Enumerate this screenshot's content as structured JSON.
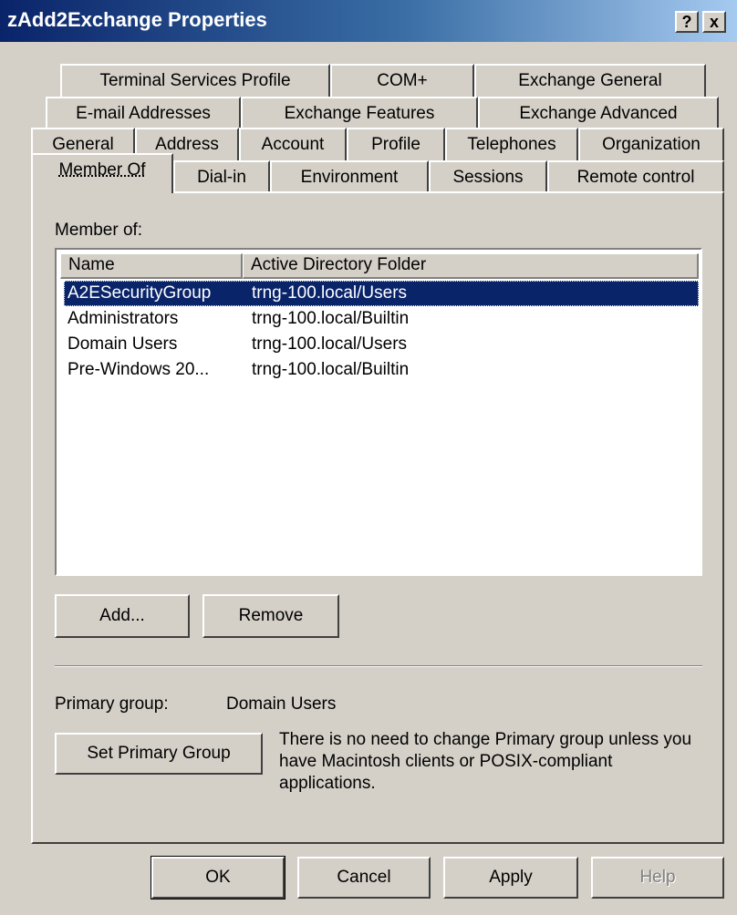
{
  "window": {
    "title": "zAdd2Exchange Properties",
    "help_button": "?",
    "close_button": "x"
  },
  "tabs": {
    "row1": [
      "Terminal Services Profile",
      "COM+",
      "Exchange General"
    ],
    "row2": [
      "E-mail Addresses",
      "Exchange Features",
      "Exchange Advanced"
    ],
    "row3": [
      "General",
      "Address",
      "Account",
      "Profile",
      "Telephones",
      "Organization"
    ],
    "row4": [
      "Member Of",
      "Dial-in",
      "Environment",
      "Sessions",
      "Remote control"
    ],
    "active": "Member Of"
  },
  "member_of": {
    "label": "Member of:",
    "columns": [
      "Name",
      "Active Directory Folder"
    ],
    "rows": [
      {
        "name": "A2ESecurityGroup",
        "folder": "trng-100.local/Users",
        "selected": true
      },
      {
        "name": "Administrators",
        "folder": "trng-100.local/Builtin",
        "selected": false
      },
      {
        "name": "Domain Users",
        "folder": "trng-100.local/Users",
        "selected": false
      },
      {
        "name": "Pre-Windows 20...",
        "folder": "trng-100.local/Builtin",
        "selected": false
      }
    ],
    "add_button": "Add...",
    "remove_button": "Remove"
  },
  "primary": {
    "label": "Primary group:",
    "value": "Domain Users",
    "set_button": "Set Primary Group",
    "note": "There is no need to change Primary group unless you have Macintosh clients or POSIX-compliant applications."
  },
  "footer": {
    "ok": "OK",
    "cancel": "Cancel",
    "apply": "Apply",
    "help": "Help"
  }
}
